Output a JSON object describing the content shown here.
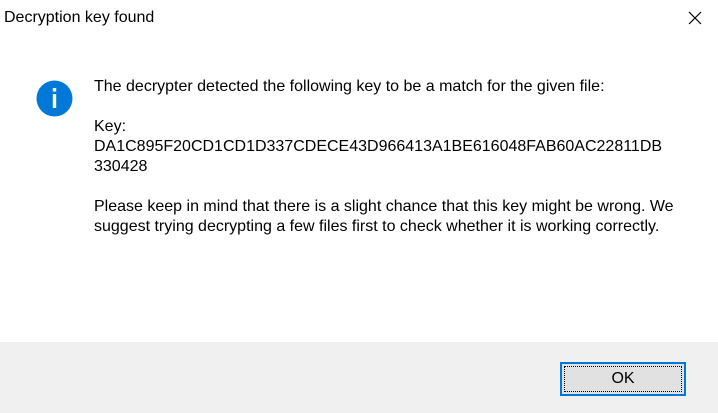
{
  "window": {
    "title": "Decryption key found",
    "close_icon": "close-icon"
  },
  "message": {
    "icon": "info-icon",
    "intro": "The decrypter detected the following key to be a match for the given file:",
    "key_label": "Key:",
    "key_value": "DA1C895F20CD1CD1D337CDECE43D966413A1BE616048FAB60AC22811DB330428",
    "warning": "Please keep in mind that there is a slight chance that this key might be wrong. We suggest trying decrypting a few files first to check whether it is working correctly."
  },
  "footer": {
    "ok_label": "OK"
  },
  "colors": {
    "icon_blue": "#0078d7",
    "footer_bg": "#f0f0f0",
    "button_bg": "#e1e1e1",
    "button_border": "#0078d7"
  }
}
